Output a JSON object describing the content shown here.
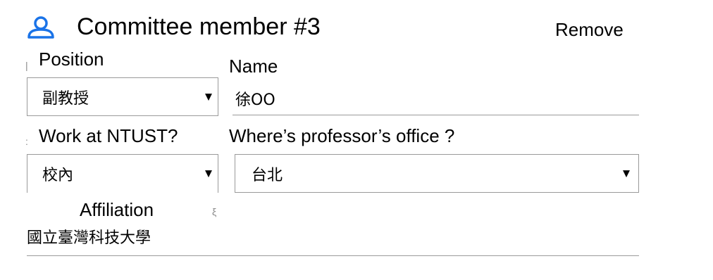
{
  "header": {
    "title": "Committee member #3",
    "remove_label": "Remove",
    "icon": "user-icon",
    "accent_color": "#1a73e8"
  },
  "position": {
    "label": "Position",
    "value": "副教授"
  },
  "name": {
    "label": "Name",
    "value": "徐OO"
  },
  "work_at_ntust": {
    "label": "Work at NTUST?",
    "value": "校內"
  },
  "office": {
    "label": "Where’s professor’s office ?",
    "value": "台北"
  },
  "affiliation": {
    "label": "Affiliation",
    "value": "國立臺灣科技大學"
  }
}
